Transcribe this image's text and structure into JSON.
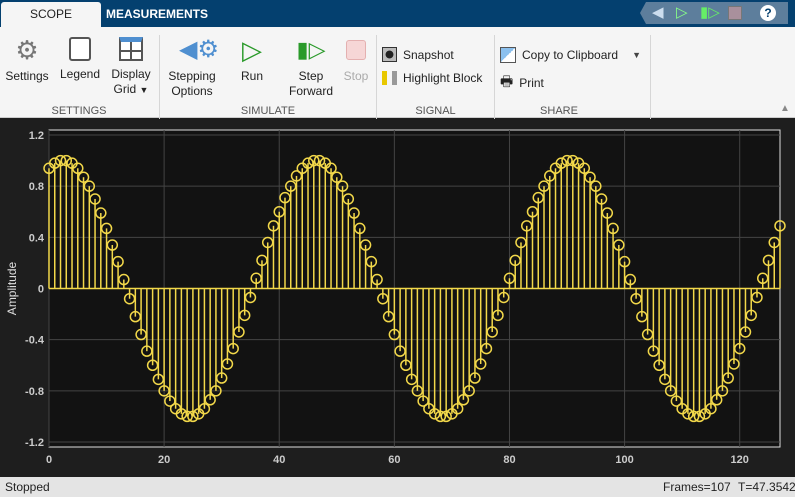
{
  "tabs": [
    "SCOPE",
    "MEASUREMENTS"
  ],
  "quick_access": {
    "icons": [
      "stepping-options-icon",
      "run-icon",
      "step-forward-icon",
      "stop-icon",
      "help-icon"
    ]
  },
  "ribbon": {
    "settings": {
      "label": "Settings",
      "legend": "Legend",
      "display_grid_1": "Display",
      "display_grid_2": "Grid",
      "group": "SETTINGS"
    },
    "simulate": {
      "stepping_1": "Stepping",
      "stepping_2": "Options",
      "run": "Run",
      "step_1": "Step",
      "step_2": "Forward",
      "stop": "Stop",
      "group": "SIMULATE"
    },
    "signal": {
      "snapshot": "Snapshot",
      "highlight": "Highlight Block",
      "group": "SIGNAL"
    },
    "share": {
      "copy": "Copy to Clipboard",
      "print": "Print",
      "group": "SHARE"
    }
  },
  "colors": {
    "stem": "#f2d84a",
    "plot_bg": "#121212",
    "accent": "#04406f"
  },
  "chart_data": {
    "type": "stem",
    "ylabel": "Amplitude",
    "xlabel": "",
    "xlim": [
      0,
      127
    ],
    "ylim": [
      -1.2,
      1.2
    ],
    "xticks": [
      "0",
      "20",
      "40",
      "60",
      "80",
      "100",
      "120"
    ],
    "yticks": [
      "1.2",
      "0.8",
      "0.4",
      "0",
      "-0.4",
      "-0.8",
      "-1.2"
    ],
    "grid": true,
    "values": [
      0.94,
      0.98,
      1.0,
      1.0,
      0.98,
      0.94,
      0.87,
      0.8,
      0.7,
      0.59,
      0.47,
      0.34,
      0.21,
      0.07,
      -0.08,
      -0.22,
      -0.36,
      -0.49,
      -0.6,
      -0.71,
      -0.8,
      -0.88,
      -0.94,
      -0.98,
      -1.0,
      -1.0,
      -0.98,
      -0.94,
      -0.87,
      -0.8,
      -0.7,
      -0.59,
      -0.47,
      -0.34,
      -0.21,
      -0.07,
      0.08,
      0.22,
      0.36,
      0.49,
      0.6,
      0.71,
      0.8,
      0.88,
      0.94,
      0.98,
      1.0,
      1.0,
      0.98,
      0.94,
      0.87,
      0.8,
      0.7,
      0.59,
      0.47,
      0.34,
      0.21,
      0.07,
      -0.08,
      -0.22,
      -0.36,
      -0.49,
      -0.6,
      -0.71,
      -0.8,
      -0.88,
      -0.94,
      -0.98,
      -1.0,
      -1.0,
      -0.98,
      -0.94,
      -0.87,
      -0.8,
      -0.7,
      -0.59,
      -0.47,
      -0.34,
      -0.21,
      -0.07,
      0.08,
      0.22,
      0.36,
      0.49,
      0.6,
      0.71,
      0.8,
      0.88,
      0.94,
      0.98,
      1.0,
      1.0,
      0.98,
      0.94,
      0.87,
      0.8,
      0.7,
      0.59,
      0.47,
      0.34,
      0.21,
      0.07,
      -0.08,
      -0.22,
      -0.36,
      -0.49,
      -0.6,
      -0.71,
      -0.8,
      -0.88,
      -0.94,
      -0.98,
      -1.0,
      -1.0,
      -0.98,
      -0.94,
      -0.87,
      -0.8,
      -0.7,
      -0.59,
      -0.47,
      -0.34,
      -0.21,
      -0.07,
      0.08,
      0.22,
      0.36,
      0.49
    ]
  },
  "status": {
    "state": "Stopped",
    "frames": "Frames=107",
    "time": "T=47.3542"
  }
}
